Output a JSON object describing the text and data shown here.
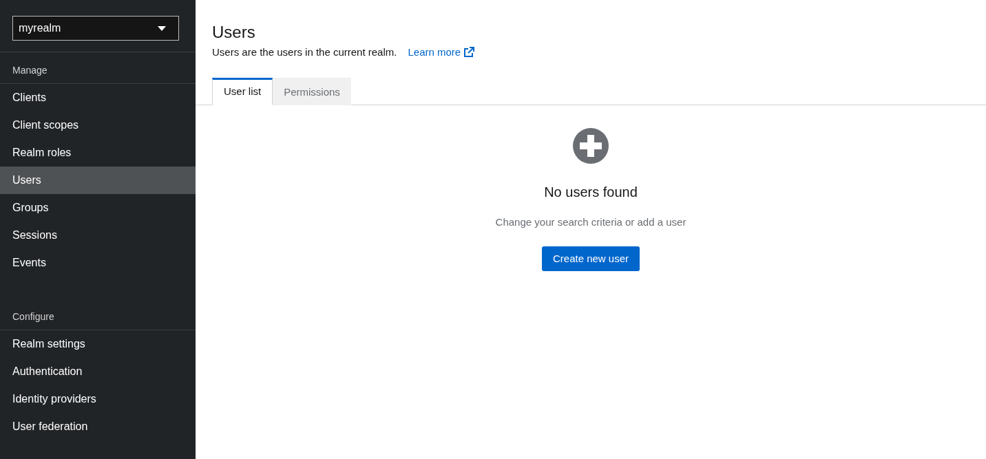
{
  "sidebar": {
    "realm_select": {
      "value": "myrealm"
    },
    "sections": [
      {
        "heading": "Manage",
        "items": [
          {
            "label": "Clients",
            "selected": false
          },
          {
            "label": "Client scopes",
            "selected": false
          },
          {
            "label": "Realm roles",
            "selected": false
          },
          {
            "label": "Users",
            "selected": true
          },
          {
            "label": "Groups",
            "selected": false
          },
          {
            "label": "Sessions",
            "selected": false
          },
          {
            "label": "Events",
            "selected": false
          }
        ]
      },
      {
        "heading": "Configure",
        "items": [
          {
            "label": "Realm settings",
            "selected": false
          },
          {
            "label": "Authentication",
            "selected": false
          },
          {
            "label": "Identity providers",
            "selected": false
          },
          {
            "label": "User federation",
            "selected": false
          }
        ]
      }
    ]
  },
  "page": {
    "title": "Users",
    "description": "Users are the users in the current realm.",
    "learn_more": "Learn more"
  },
  "tabs": [
    {
      "label": "User list",
      "selected": true
    },
    {
      "label": "Permissions",
      "selected": false
    }
  ],
  "empty_state": {
    "title": "No users found",
    "body": "Change your search criteria or add a user",
    "button": "Create new user"
  }
}
